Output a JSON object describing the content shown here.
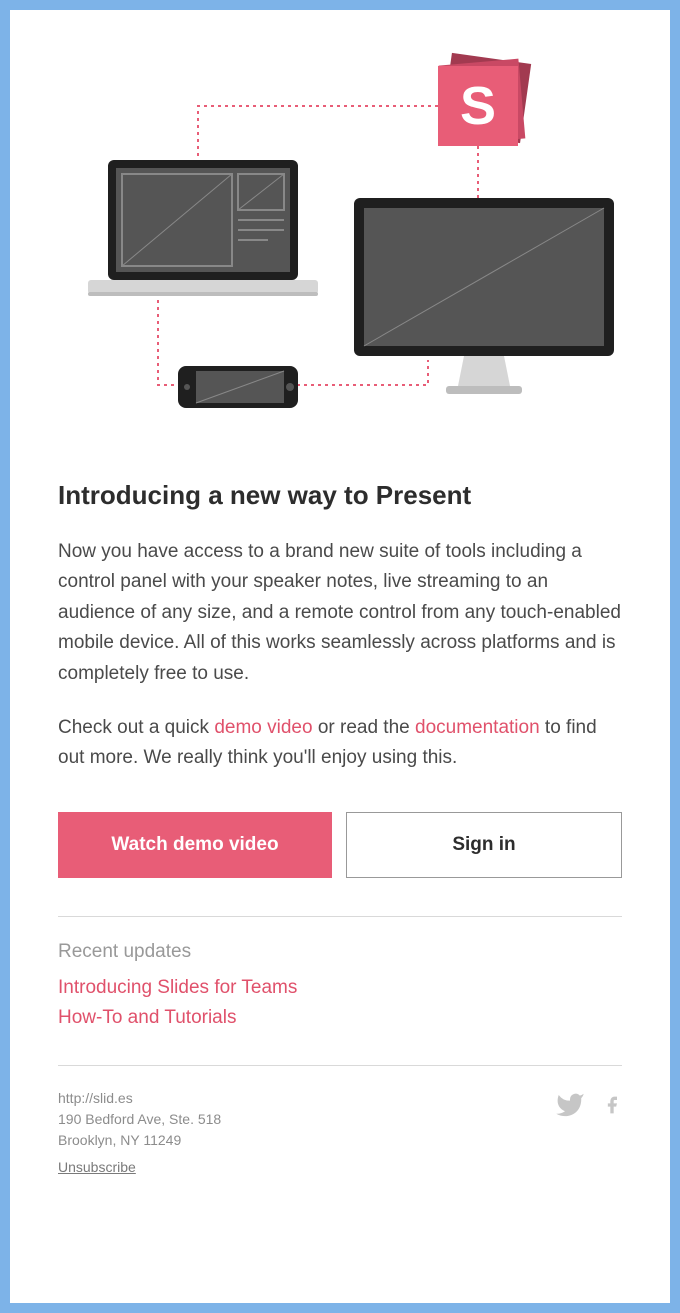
{
  "hero": {
    "logo_letter": "S"
  },
  "headline": "Introducing a new way to Present",
  "paragraph1": "Now you have access to a brand new suite of tools including a control panel with your speaker notes, live streaming to an audience of any size, and a remote control from any touch-enabled mobile device. All of this works seamlessly across platforms and is completely free to use.",
  "p2_prefix": "Check out a quick ",
  "p2_link1": "demo video",
  "p2_mid": " or read the ",
  "p2_link2": "documentation",
  "p2_suffix": " to find out more. We really think you'll enjoy using this.",
  "cta_primary": "Watch demo video",
  "cta_secondary": "Sign in",
  "updates_title": "Recent updates",
  "updates": [
    "Introducing Slides for Teams",
    "How-To and Tutorials"
  ],
  "footer": {
    "url": "http://slid.es",
    "address1": "190 Bedford Ave, Ste. 518",
    "address2": "Brooklyn, NY 11249",
    "unsubscribe": "Unsubscribe"
  }
}
